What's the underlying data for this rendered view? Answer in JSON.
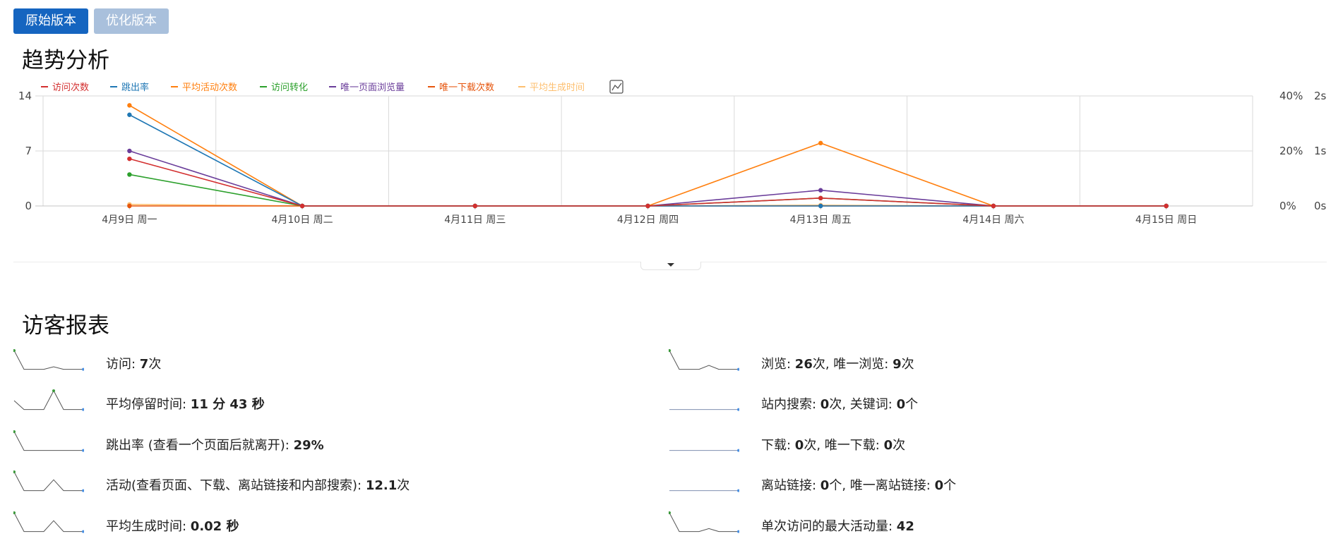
{
  "buttons": {
    "original": "原始版本",
    "optimized": "优化版本"
  },
  "trend": {
    "title": "趋势分析",
    "legend": [
      {
        "label": "访问次数",
        "color": "#d32f2f"
      },
      {
        "label": "跳出率",
        "color": "#1f77b4"
      },
      {
        "label": "平均活动次数",
        "color": "#ff7f0e"
      },
      {
        "label": "访问转化",
        "color": "#2ca02c"
      },
      {
        "label": "唯一页面浏览量",
        "color": "#6a3d9a"
      },
      {
        "label": "唯一下载次数",
        "color": "#e6550d"
      },
      {
        "label": "平均生成时间",
        "color": "#fdbf6f"
      }
    ]
  },
  "chart_data": {
    "type": "line",
    "categories": [
      "4月9日 周一",
      "4月10日 周二",
      "4月11日 周三",
      "4月12日 周四",
      "4月13日 周五",
      "4月14日 周六",
      "4月15日 周日"
    ],
    "y_left_ticks": [
      "0",
      "7",
      "14"
    ],
    "y_right_ticks_percent": [
      "0%",
      "20%",
      "40%"
    ],
    "y_right_ticks_seconds": [
      "0s",
      "1s",
      "2s"
    ],
    "ylim": [
      0,
      14
    ],
    "grid": true,
    "legend_position": "top",
    "series": [
      {
        "name": "访问次数",
        "color": "#d32f2f",
        "values": [
          6,
          0,
          0,
          0,
          1,
          0,
          0
        ]
      },
      {
        "name": "跳出率",
        "color": "#1f77b4",
        "values": [
          11.6,
          0,
          0,
          0,
          0,
          0,
          0
        ]
      },
      {
        "name": "平均活动次数",
        "color": "#ff7f0e",
        "values": [
          12.8,
          0,
          0,
          0,
          8,
          0,
          0
        ]
      },
      {
        "name": "访问转化",
        "color": "#2ca02c",
        "values": [
          4,
          0,
          0,
          0,
          1,
          0,
          0
        ]
      },
      {
        "name": "唯一页面浏览量",
        "color": "#6a3d9a",
        "values": [
          7,
          0,
          0,
          0,
          2,
          0,
          0
        ]
      },
      {
        "name": "唯一下载次数",
        "color": "#e6550d",
        "values": [
          0,
          0,
          0,
          0,
          0,
          0,
          0
        ]
      },
      {
        "name": "平均生成时间",
        "color": "#fdbf6f",
        "values": [
          0.2,
          0,
          0,
          0,
          0.1,
          0,
          0
        ]
      }
    ]
  },
  "visitors": {
    "title": "访客报表",
    "left": [
      {
        "parts": [
          [
            "访问: ",
            false
          ],
          [
            "7",
            true
          ],
          [
            "次",
            false
          ]
        ],
        "spark": [
          1,
          0.05,
          0.05,
          0.05,
          0.18,
          0.05,
          0.05,
          0.05
        ],
        "hl": 0
      },
      {
        "parts": [
          [
            "平均停留时间: ",
            false
          ],
          [
            "11 分 43 秒",
            true
          ]
        ],
        "spark": [
          0.5,
          0.05,
          0.05,
          0.05,
          1,
          0.05,
          0.05,
          0.05
        ],
        "hl": 4
      },
      {
        "parts": [
          [
            "跳出率 (查看一个页面后就离开): ",
            false
          ],
          [
            "29%",
            true
          ]
        ],
        "spark": [
          1,
          0.05,
          0.05,
          0.05,
          0.05,
          0.05,
          0.05,
          0.05
        ],
        "hl": 0
      },
      {
        "parts": [
          [
            "活动(查看页面、下载、离站链接和内部搜索): ",
            false
          ],
          [
            "12.1",
            true
          ],
          [
            "次",
            false
          ]
        ],
        "spark": [
          1,
          0.05,
          0.05,
          0.05,
          0.6,
          0.05,
          0.05,
          0.05
        ],
        "hl": 0
      },
      {
        "parts": [
          [
            "平均生成时间: ",
            false
          ],
          [
            "0.02 秒",
            true
          ]
        ],
        "spark": [
          1,
          0.05,
          0.05,
          0.05,
          0.6,
          0.05,
          0.05,
          0.05
        ],
        "hl": 0
      }
    ],
    "right": [
      {
        "parts": [
          [
            "浏览: ",
            false
          ],
          [
            "26",
            true
          ],
          [
            "次, 唯一浏览: ",
            false
          ],
          [
            "9",
            true
          ],
          [
            "次",
            false
          ]
        ],
        "spark": [
          1,
          0.05,
          0.05,
          0.05,
          0.25,
          0.05,
          0.05,
          0.05
        ],
        "hl": 0
      },
      {
        "parts": [
          [
            "站内搜索: ",
            false
          ],
          [
            "0",
            true
          ],
          [
            "次, 关键词: ",
            false
          ],
          [
            "0",
            true
          ],
          [
            "个",
            false
          ]
        ],
        "spark": [
          0.05,
          0.05,
          0.05,
          0.05,
          0.05,
          0.05,
          0.05,
          0.05
        ],
        "hl": -1
      },
      {
        "parts": [
          [
            "下载: ",
            false
          ],
          [
            "0",
            true
          ],
          [
            "次, 唯一下载: ",
            false
          ],
          [
            "0",
            true
          ],
          [
            "次",
            false
          ]
        ],
        "spark": [
          0.05,
          0.05,
          0.05,
          0.05,
          0.05,
          0.05,
          0.05,
          0.05
        ],
        "hl": -1
      },
      {
        "parts": [
          [
            "离站链接: ",
            false
          ],
          [
            "0",
            true
          ],
          [
            "个, 唯一离站链接: ",
            false
          ],
          [
            "0",
            true
          ],
          [
            "个",
            false
          ]
        ],
        "spark": [
          0.05,
          0.05,
          0.05,
          0.05,
          0.05,
          0.05,
          0.05,
          0.05
        ],
        "hl": -1
      },
      {
        "parts": [
          [
            "单次访问的最大活动量: ",
            false
          ],
          [
            "42",
            true
          ]
        ],
        "spark": [
          1,
          0.05,
          0.05,
          0.05,
          0.2,
          0.05,
          0.05,
          0.05
        ],
        "hl": 0
      }
    ]
  }
}
